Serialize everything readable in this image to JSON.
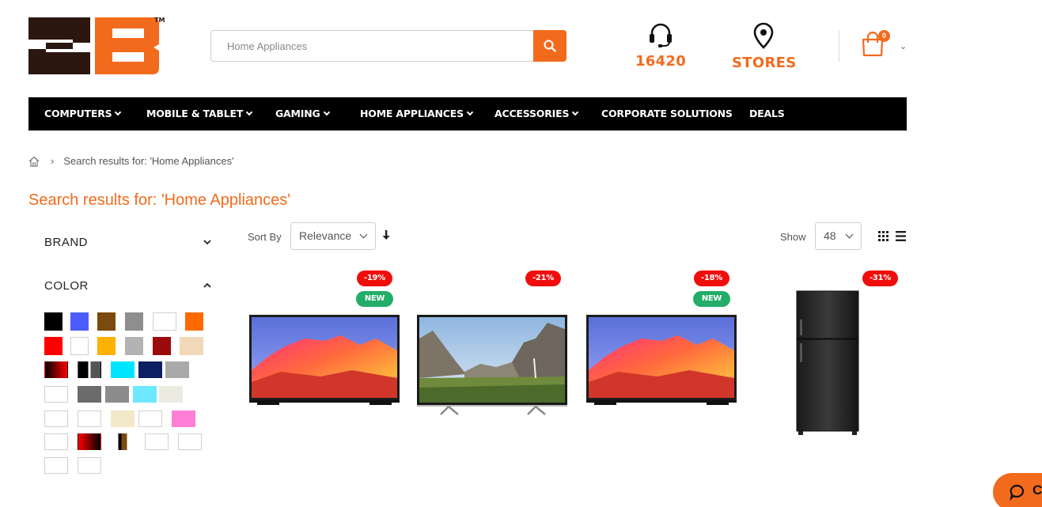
{
  "header": {
    "logo_alt": "2B",
    "search_placeholder": "Home Appliances",
    "hotline": "16420",
    "stores": "STORES",
    "cart_count": "0"
  },
  "nav": {
    "items": [
      {
        "label": "COMPUTERS",
        "dropdown": true
      },
      {
        "label": "MOBILE & TABLET",
        "dropdown": true
      },
      {
        "label": "GAMING",
        "dropdown": true
      },
      {
        "label": "HOME APPLIANCES",
        "dropdown": true
      },
      {
        "label": "ACCESSORIES",
        "dropdown": true
      },
      {
        "label": "CORPORATE SOLUTIONS",
        "dropdown": false
      },
      {
        "label": "DEALS",
        "dropdown": false
      }
    ]
  },
  "breadcrumb": {
    "current": "Search results for: 'Home Appliances'"
  },
  "page_title": "Search results for: 'Home Appliances'",
  "filters": {
    "brand": "BRAND",
    "color": "COLOR",
    "swatches": [
      [
        "#000000",
        "#4d5cff",
        "#7a4a0e",
        "#8e8e8e",
        "#ffffff",
        "#ff6a00"
      ],
      [
        "#ff0000",
        "#ffffff",
        "#ffb000",
        "#b3b3b3",
        "#9b0b0b",
        "#f0d8b8"
      ],
      [
        "black-red-gradient",
        "black-grey-split",
        "#00e5ff",
        "#0c1f63",
        "#a9a9a9"
      ],
      [
        "#ffffff",
        "#6b6b6b",
        "#8c8c8c",
        "#6ce9ff",
        "#ecebe0"
      ],
      [
        "#ffffff",
        "#ffffff",
        "#f1e9c8",
        "#ffffff",
        "#ff7fd6"
      ],
      [
        "#ffffff",
        "red-black-gradient",
        "brown-split",
        "#ffffff",
        "#ffffff"
      ],
      [
        "#ffffff",
        "#ffffff"
      ]
    ]
  },
  "toolbar": {
    "sort_label": "Sort By",
    "sort_value": "Relevance",
    "show_label": "Show",
    "limit_value": "48"
  },
  "products": [
    {
      "discount": "-19%",
      "new_label": "NEW",
      "type": "tv-samsung"
    },
    {
      "discount": "-21%",
      "type": "tv-sony"
    },
    {
      "discount": "-18%",
      "new_label": "NEW",
      "type": "tv-samsung"
    },
    {
      "discount": "-31%",
      "type": "fridge"
    }
  ],
  "chat": {
    "label": "C"
  },
  "colors": {
    "accent": "#f26b1d",
    "nav_bg": "#000000",
    "discount": "#f20d0d",
    "new": "#23ad68"
  }
}
